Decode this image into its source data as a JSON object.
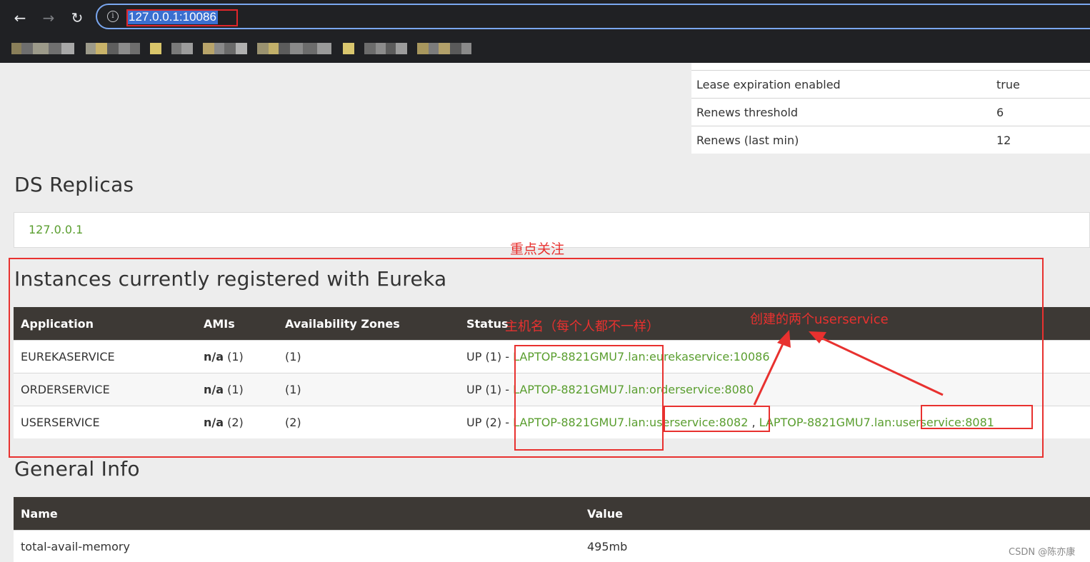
{
  "browser": {
    "url": "127.0.0.1:10086",
    "nav": {
      "back": "←",
      "forward": "→",
      "reload": "↻",
      "info": "i"
    }
  },
  "status_rows": [
    {
      "label": "Lease expiration enabled",
      "value": "true"
    },
    {
      "label": "Renews threshold",
      "value": "6"
    },
    {
      "label": "Renews (last min)",
      "value": "12"
    }
  ],
  "ds_replicas": {
    "title": "DS Replicas",
    "link": "127.0.0.1"
  },
  "instances": {
    "title": "Instances currently registered with Eureka",
    "headers": [
      "Application",
      "AMIs",
      "Availability Zones",
      "Status"
    ],
    "rows": [
      {
        "app": "EUREKASERVICE",
        "ami": "n/a",
        "ami_count": "(1)",
        "zones": "(1)",
        "status": "UP (1) - ",
        "links": [
          "LAPTOP-8821GMU7.lan:eurekaservice:10086"
        ]
      },
      {
        "app": "ORDERSERVICE",
        "ami": "n/a",
        "ami_count": "(1)",
        "zones": "(1)",
        "status": "UP (1) - ",
        "links": [
          "LAPTOP-8821GMU7.lan:orderservice:8080"
        ]
      },
      {
        "app": "USERSERVICE",
        "ami": "n/a",
        "ami_count": "(2)",
        "zones": "(2)",
        "status": "UP (2) - ",
        "links": [
          "LAPTOP-8821GMU7.lan:userservice:8082",
          "LAPTOP-8821GMU7.lan:userservice:8081"
        ],
        "link_separator": " , "
      }
    ]
  },
  "general_info": {
    "title": "General Info",
    "headers": [
      "Name",
      "Value"
    ],
    "rows": [
      {
        "name": "total-avail-memory",
        "value": "495mb"
      }
    ]
  },
  "annotations": {
    "focus": "重点关注",
    "hostname": "主机名（每个人都不一样）",
    "two_services": "创建的两个userservice",
    "color": "#e8312f"
  },
  "watermark": "CSDN @陈亦康",
  "colors": {
    "link": "#5a9e2f",
    "header": "#3d3935",
    "chrome": "#202124"
  }
}
